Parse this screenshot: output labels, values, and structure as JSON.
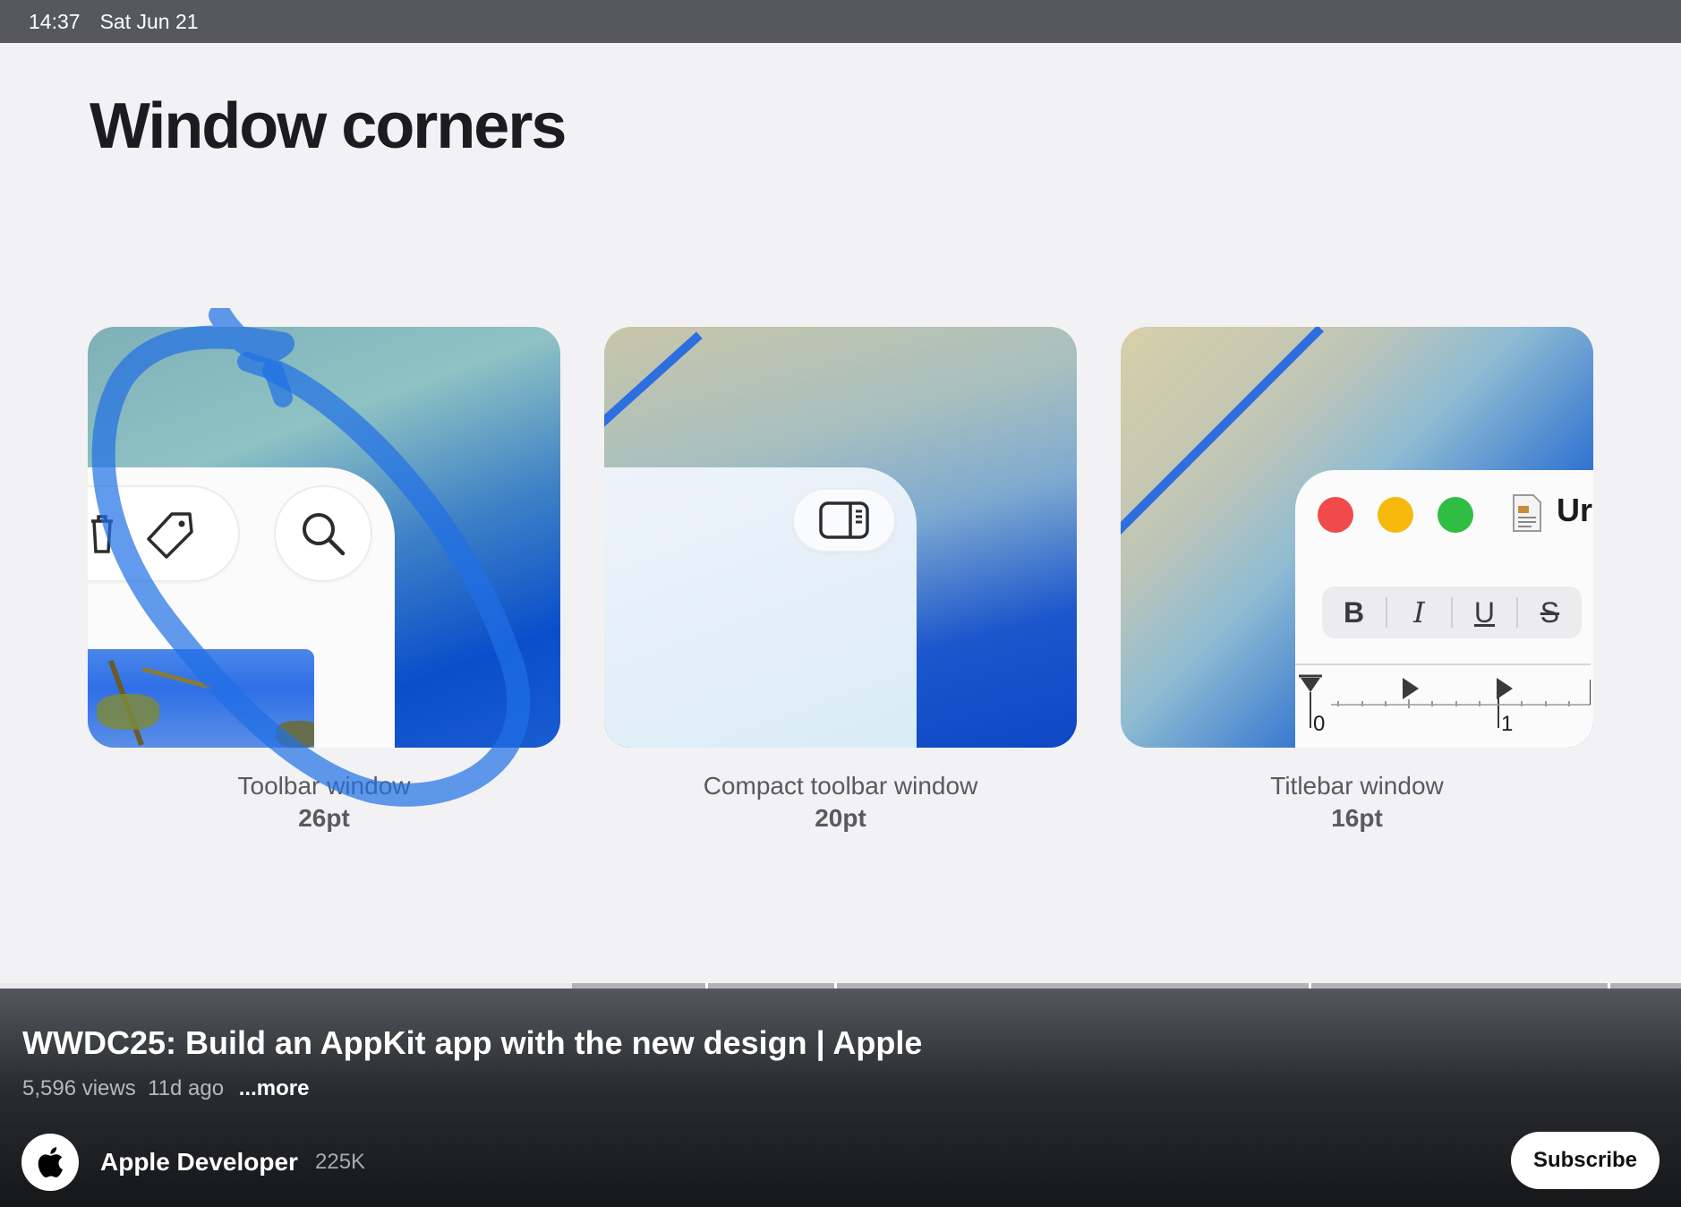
{
  "status_bar": {
    "time": "14:37",
    "date": "Sat Jun 21"
  },
  "slide": {
    "title": "Window corners",
    "cards": [
      {
        "label": "Toolbar window",
        "radius": "26pt"
      },
      {
        "label": "Compact toolbar window",
        "radius": "20pt"
      },
      {
        "label": "Titlebar window",
        "radius": "16pt",
        "window_title_fragment": "Ur",
        "ruler_marks": [
          "0",
          "1"
        ],
        "format_buttons": [
          "B",
          "I",
          "U",
          "S"
        ]
      }
    ]
  },
  "video": {
    "title": "WWDC25: Build an AppKit app with the new design | Apple",
    "views": "5,596 views",
    "age": "11d ago",
    "more_label": "...more",
    "progress": 0.34
  },
  "channel": {
    "name": "Apple Developer",
    "subscribers": "225K",
    "subscribe_label": "Subscribe"
  },
  "colors": {
    "status_bar": "#56585c",
    "slide_bg": "#f2f2f4",
    "scribble": "#1f6fe6",
    "traffic_red": "#f14a4a",
    "traffic_yellow": "#f6b90b",
    "traffic_green": "#2fbd44"
  }
}
